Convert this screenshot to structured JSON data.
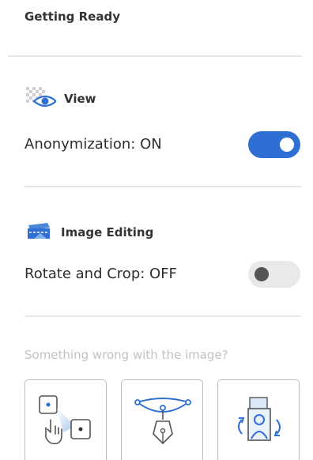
{
  "header": {
    "title": "Getting Ready"
  },
  "view_section": {
    "title": "View",
    "icon": "anonymization-eye-icon",
    "setting_label": "Anonymization: ON",
    "toggle_state": "on"
  },
  "image_editing_section": {
    "title": "Image Editing",
    "icon": "image-editing-icon",
    "setting_label": "Rotate and Crop: OFF",
    "toggle_state": "off"
  },
  "problem_prompt": "Something wrong with the image?",
  "tools": [
    {
      "icon": "drag-points-icon"
    },
    {
      "icon": "pen-path-icon"
    },
    {
      "icon": "rotate-portrait-icon"
    }
  ],
  "colors": {
    "accent": "#2f6fd4",
    "divider": "#e6e6e6",
    "hint_text": "#c2c2c2"
  }
}
